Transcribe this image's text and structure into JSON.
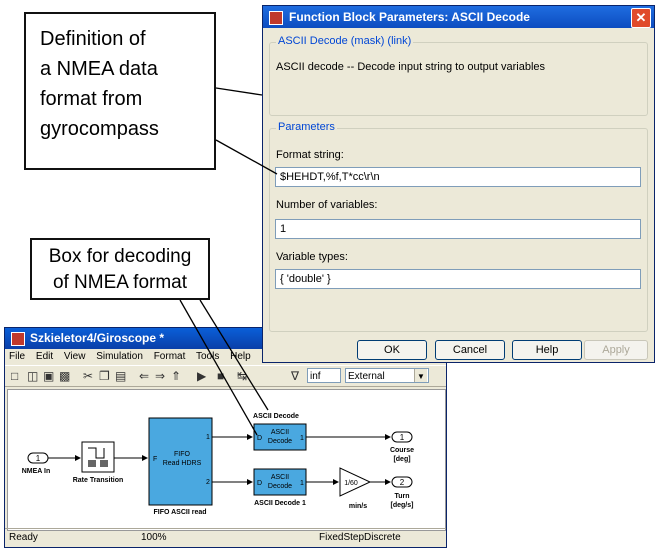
{
  "callouts": {
    "definition": [
      "Definition of",
      "a NMEA data",
      "format from",
      "gyrocompass"
    ],
    "box": [
      "Box for decoding",
      "of NMEA format"
    ]
  },
  "dialog": {
    "title": "Function Block Parameters: ASCII Decode",
    "mask_group": "ASCII Decode (mask) (link)",
    "description": "ASCII decode -- Decode input string to output variables",
    "params_group": "Parameters",
    "format_label": "Format string:",
    "format_value": "$HEHDT,%f,T*cc\\r\\n",
    "numvars_label": "Number of variables:",
    "numvars_value": "1",
    "types_label": "Variable types:",
    "types_value": "{ 'double' }",
    "buttons": {
      "ok": "OK",
      "cancel": "Cancel",
      "help": "Help",
      "apply": "Apply"
    }
  },
  "simulink": {
    "title": "Szkieletor4/Giroscope *",
    "menu": [
      "File",
      "Edit",
      "View",
      "Simulation",
      "Format",
      "Tools",
      "Help"
    ],
    "stop_time": "inf",
    "mode": "External",
    "blocks": {
      "nmea_in_port": "1",
      "nmea_in": "NMEA In",
      "rate_transition": "Rate Transition",
      "fifo_label": "FIFO\nRead HDRS",
      "fifo_line1": "FIFO",
      "fifo_line2": "Read HDRS",
      "fifo_name": "FIFO ASCII read",
      "fifo_port1": "1",
      "fifo_port2": "2",
      "fifo_in": "F",
      "decode_line1": "ASCII",
      "decode_line2": "Decode",
      "decode_port_in": "D",
      "decode_port_out": "1",
      "decode1_name": "ASCII Decode",
      "decode2_name": "ASCII Decode 1",
      "gain": "1/60",
      "gain_name": "min/s",
      "out1_port": "1",
      "out1_line1": "Course",
      "out1_line2": "[deg]",
      "out2_port": "2",
      "out2_line1": "Turn",
      "out2_line2": "[deg/s]"
    },
    "status": {
      "ready": "Ready",
      "zoom": "100%",
      "solver": "FixedStepDiscrete"
    }
  },
  "colors": {
    "block_fill": "#4aa8e0",
    "titlebar": "#0a4cc0"
  }
}
